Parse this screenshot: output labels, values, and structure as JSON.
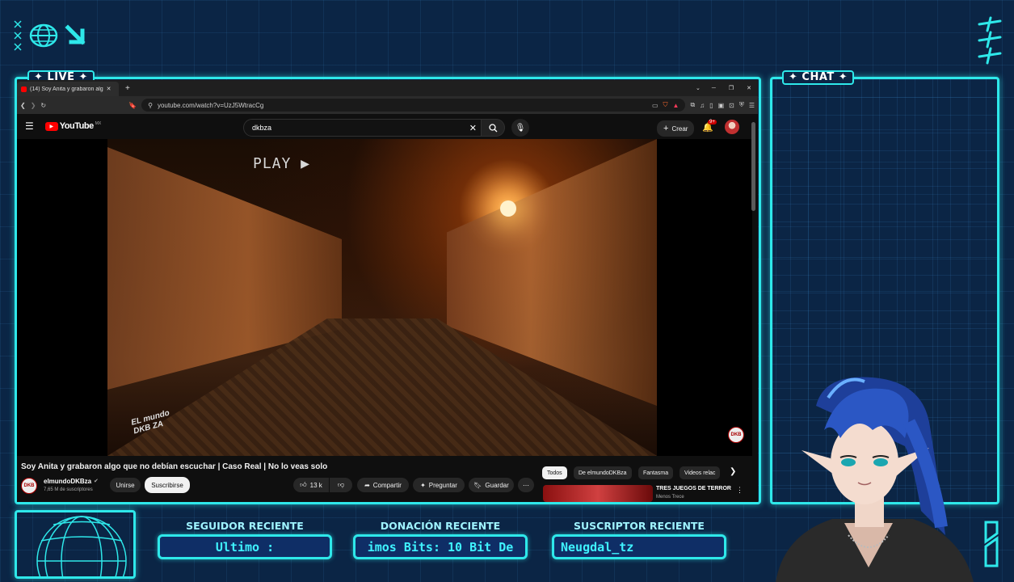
{
  "overlay": {
    "live_label": "✦ LIVE ✦",
    "chat_label": "✦ CHAT ✦",
    "accent": "#2ee8ea",
    "background": "#0b2545",
    "stats": [
      {
        "title": "SEGUIDOR RECIENTE",
        "value": "Ultimo :"
      },
      {
        "title": "DONACIÓN RECIENTE",
        "value": "imos Bits: 10 Bit De"
      },
      {
        "title": "SUSCRIPTOR RECIENTE",
        "value": "Neugdal_tz"
      }
    ]
  },
  "browser": {
    "tab_title": "(14) Soy Anita y grabaron alg",
    "url": "youtube.com/watch?v=UzJ5WtracCg"
  },
  "youtube": {
    "logo": "YouTube",
    "region": "MX",
    "search_value": "dkbza",
    "create_label": "Crear",
    "notifications_badge": "9+",
    "video": {
      "overlay_text": "PLAY ▶",
      "watermark": "EL mundo DKB ZA",
      "title": "Soy Anita y grabaron algo que no debían escuchar | Caso Real | No lo veas solo",
      "channel": "elmundoDKBza",
      "subscribers": "7,65 M de suscriptores",
      "join_label": "Unirse",
      "subscribe_label": "Suscribirse",
      "likes": "13 k",
      "share_label": "Compartir",
      "ask_label": "Preguntar",
      "save_label": "Guardar"
    },
    "chips": [
      "Todos",
      "De elmundoDKBza",
      "Fantasma",
      "Videos relac"
    ],
    "related": {
      "title": "TRES JUEGOS DE TERROR",
      "channel": "Menos Trece"
    }
  }
}
